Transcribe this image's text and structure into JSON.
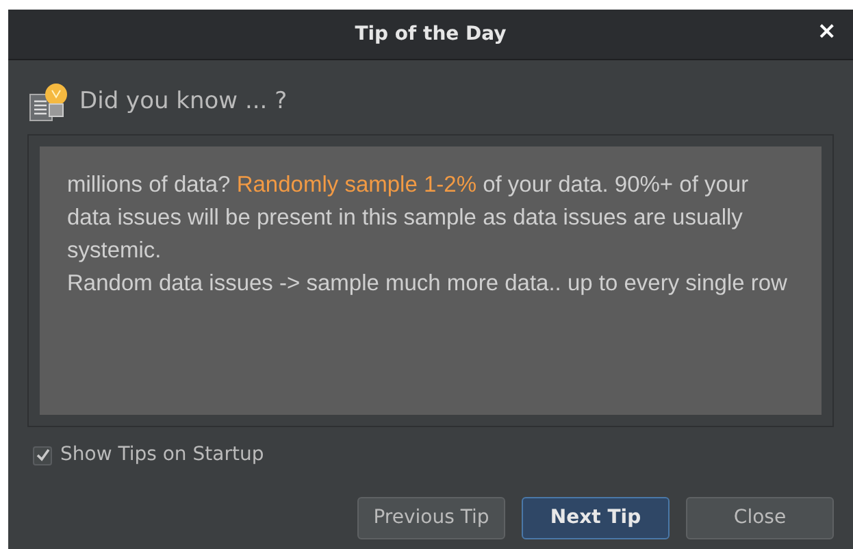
{
  "window": {
    "title": "Tip of the Day",
    "close": "×"
  },
  "heading": "Did you know ... ?",
  "tip": {
    "paragraphs": [
      {
        "segments": [
          {
            "text": "millions of data? ",
            "highlight": false
          },
          {
            "text": "Randomly sample 1-2%",
            "highlight": true
          },
          {
            "text": " of your data. 90%+ of your data issues will be present in this sample as data issues are usually systemic.",
            "highlight": false
          }
        ]
      },
      {
        "segments": [
          {
            "text": "Random data issues -> sample much more data.. up to every single row",
            "highlight": false
          }
        ]
      }
    ]
  },
  "show_on_startup": {
    "label": "Show Tips on Startup",
    "checked": true
  },
  "buttons": [
    {
      "label": "Previous Tip",
      "default": false
    },
    {
      "label": "Next Tip",
      "default": true
    },
    {
      "label": "Close",
      "default": false
    }
  ]
}
